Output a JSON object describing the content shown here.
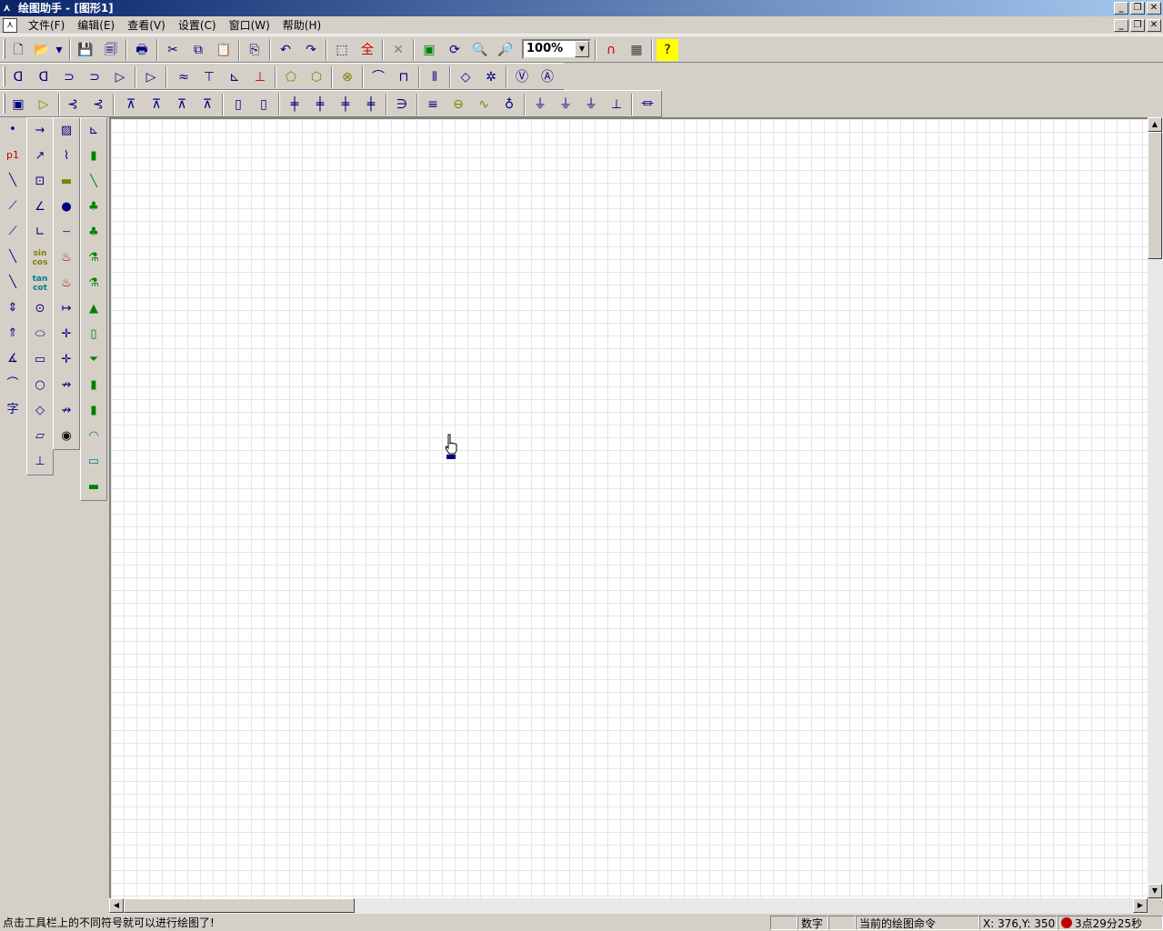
{
  "window": {
    "title": "绘图助手 - [图形1]"
  },
  "window_buttons": [
    "_",
    "❐",
    "✕"
  ],
  "menu": [
    "文件(F)",
    "编辑(E)",
    "查看(V)",
    "设置(C)",
    "窗口(W)",
    "帮助(H)"
  ],
  "toolbar": {
    "zoom_value": "100%"
  },
  "left_tools": {
    "text_tool": "字",
    "sin_label": "sin\ncos",
    "tan_label": "tan\ncot",
    "p1_label": "p1"
  },
  "status": {
    "hint": "点击工具栏上的不同符号就可以进行绘图了!",
    "mode": "数字",
    "command": "当前的绘图命令",
    "coords": "X: 376,Y: 350",
    "time": "3点29分25秒"
  }
}
